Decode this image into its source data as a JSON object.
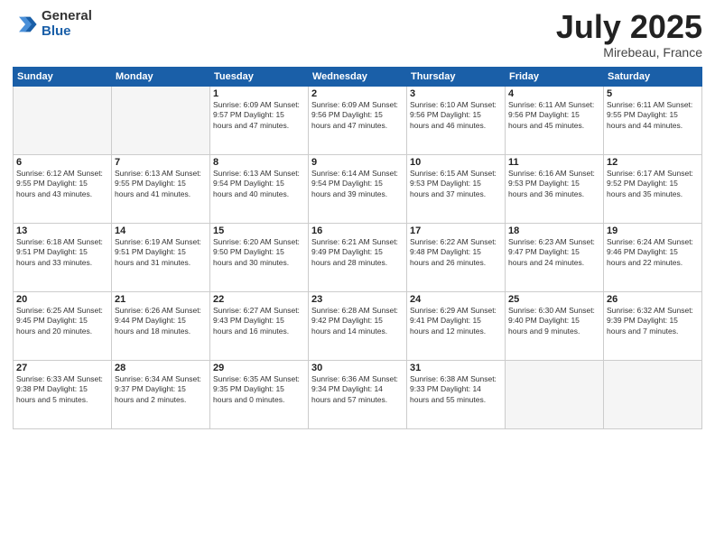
{
  "logo": {
    "general": "General",
    "blue": "Blue"
  },
  "title": "July 2025",
  "subtitle": "Mirebeau, France",
  "headers": [
    "Sunday",
    "Monday",
    "Tuesday",
    "Wednesday",
    "Thursday",
    "Friday",
    "Saturday"
  ],
  "weeks": [
    [
      {
        "day": "",
        "info": ""
      },
      {
        "day": "",
        "info": ""
      },
      {
        "day": "1",
        "info": "Sunrise: 6:09 AM\nSunset: 9:57 PM\nDaylight: 15 hours\nand 47 minutes."
      },
      {
        "day": "2",
        "info": "Sunrise: 6:09 AM\nSunset: 9:56 PM\nDaylight: 15 hours\nand 47 minutes."
      },
      {
        "day": "3",
        "info": "Sunrise: 6:10 AM\nSunset: 9:56 PM\nDaylight: 15 hours\nand 46 minutes."
      },
      {
        "day": "4",
        "info": "Sunrise: 6:11 AM\nSunset: 9:56 PM\nDaylight: 15 hours\nand 45 minutes."
      },
      {
        "day": "5",
        "info": "Sunrise: 6:11 AM\nSunset: 9:55 PM\nDaylight: 15 hours\nand 44 minutes."
      }
    ],
    [
      {
        "day": "6",
        "info": "Sunrise: 6:12 AM\nSunset: 9:55 PM\nDaylight: 15 hours\nand 43 minutes."
      },
      {
        "day": "7",
        "info": "Sunrise: 6:13 AM\nSunset: 9:55 PM\nDaylight: 15 hours\nand 41 minutes."
      },
      {
        "day": "8",
        "info": "Sunrise: 6:13 AM\nSunset: 9:54 PM\nDaylight: 15 hours\nand 40 minutes."
      },
      {
        "day": "9",
        "info": "Sunrise: 6:14 AM\nSunset: 9:54 PM\nDaylight: 15 hours\nand 39 minutes."
      },
      {
        "day": "10",
        "info": "Sunrise: 6:15 AM\nSunset: 9:53 PM\nDaylight: 15 hours\nand 37 minutes."
      },
      {
        "day": "11",
        "info": "Sunrise: 6:16 AM\nSunset: 9:53 PM\nDaylight: 15 hours\nand 36 minutes."
      },
      {
        "day": "12",
        "info": "Sunrise: 6:17 AM\nSunset: 9:52 PM\nDaylight: 15 hours\nand 35 minutes."
      }
    ],
    [
      {
        "day": "13",
        "info": "Sunrise: 6:18 AM\nSunset: 9:51 PM\nDaylight: 15 hours\nand 33 minutes."
      },
      {
        "day": "14",
        "info": "Sunrise: 6:19 AM\nSunset: 9:51 PM\nDaylight: 15 hours\nand 31 minutes."
      },
      {
        "day": "15",
        "info": "Sunrise: 6:20 AM\nSunset: 9:50 PM\nDaylight: 15 hours\nand 30 minutes."
      },
      {
        "day": "16",
        "info": "Sunrise: 6:21 AM\nSunset: 9:49 PM\nDaylight: 15 hours\nand 28 minutes."
      },
      {
        "day": "17",
        "info": "Sunrise: 6:22 AM\nSunset: 9:48 PM\nDaylight: 15 hours\nand 26 minutes."
      },
      {
        "day": "18",
        "info": "Sunrise: 6:23 AM\nSunset: 9:47 PM\nDaylight: 15 hours\nand 24 minutes."
      },
      {
        "day": "19",
        "info": "Sunrise: 6:24 AM\nSunset: 9:46 PM\nDaylight: 15 hours\nand 22 minutes."
      }
    ],
    [
      {
        "day": "20",
        "info": "Sunrise: 6:25 AM\nSunset: 9:45 PM\nDaylight: 15 hours\nand 20 minutes."
      },
      {
        "day": "21",
        "info": "Sunrise: 6:26 AM\nSunset: 9:44 PM\nDaylight: 15 hours\nand 18 minutes."
      },
      {
        "day": "22",
        "info": "Sunrise: 6:27 AM\nSunset: 9:43 PM\nDaylight: 15 hours\nand 16 minutes."
      },
      {
        "day": "23",
        "info": "Sunrise: 6:28 AM\nSunset: 9:42 PM\nDaylight: 15 hours\nand 14 minutes."
      },
      {
        "day": "24",
        "info": "Sunrise: 6:29 AM\nSunset: 9:41 PM\nDaylight: 15 hours\nand 12 minutes."
      },
      {
        "day": "25",
        "info": "Sunrise: 6:30 AM\nSunset: 9:40 PM\nDaylight: 15 hours\nand 9 minutes."
      },
      {
        "day": "26",
        "info": "Sunrise: 6:32 AM\nSunset: 9:39 PM\nDaylight: 15 hours\nand 7 minutes."
      }
    ],
    [
      {
        "day": "27",
        "info": "Sunrise: 6:33 AM\nSunset: 9:38 PM\nDaylight: 15 hours\nand 5 minutes."
      },
      {
        "day": "28",
        "info": "Sunrise: 6:34 AM\nSunset: 9:37 PM\nDaylight: 15 hours\nand 2 minutes."
      },
      {
        "day": "29",
        "info": "Sunrise: 6:35 AM\nSunset: 9:35 PM\nDaylight: 15 hours\nand 0 minutes."
      },
      {
        "day": "30",
        "info": "Sunrise: 6:36 AM\nSunset: 9:34 PM\nDaylight: 14 hours\nand 57 minutes."
      },
      {
        "day": "31",
        "info": "Sunrise: 6:38 AM\nSunset: 9:33 PM\nDaylight: 14 hours\nand 55 minutes."
      },
      {
        "day": "",
        "info": ""
      },
      {
        "day": "",
        "info": ""
      }
    ]
  ]
}
